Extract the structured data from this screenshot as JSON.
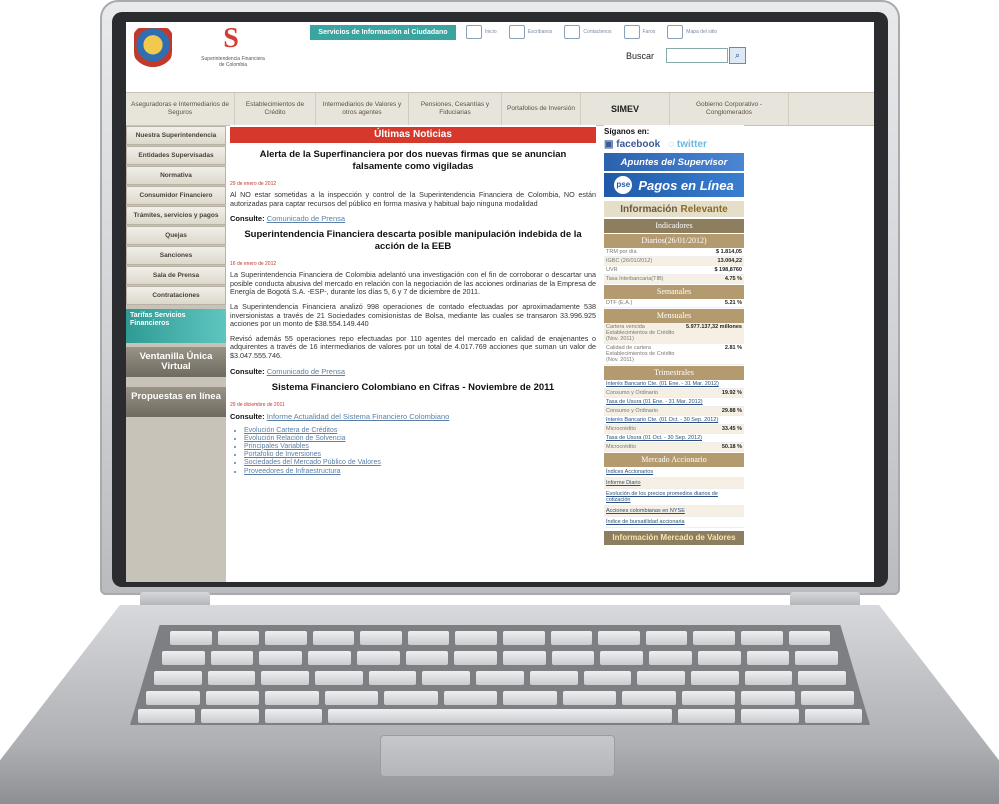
{
  "header": {
    "logo_text": "Superintendencia Financiera de Colombia",
    "services_bar": "Servicios de Información al Ciudadano",
    "top_links": [
      "Inicio",
      "Escribanos",
      "Contactenos",
      "Faros",
      "Mapa del sitio"
    ],
    "search_label": "Buscar"
  },
  "nav": [
    "Aseguradoras e Intermediarios de Seguros",
    "Establecimientos de Crédito",
    "Intermediarios de Valores y otros agentes",
    "Pensiones, Cesantías y Fiduciarias",
    "Portafolios de Inversión",
    "SIMEV",
    "Gobierno Corporativo - Conglomerados"
  ],
  "sidebar": {
    "items": [
      "Nuestra Superintendencia",
      "Entidades Supervisadas",
      "Normativa",
      "Consumidor Financiero",
      "Trámites, servicios y pagos",
      "Quejas",
      "Sanciones",
      "Sala de Prensa",
      "Contrataciones"
    ],
    "tarifas": "Tarifas Servicios Financieros",
    "ventanilla": "Ventanilla Única Virtual",
    "propuestas": "Propuestas en línea"
  },
  "main": {
    "section_title": "Últimas Noticias",
    "news": [
      {
        "title": "Alerta de la Superfinanciera por dos nuevas firmas que se anuncian falsamente como vigiladas",
        "date": "29 de enero de 2012",
        "paragraphs": [
          "Al NO estar sometidas a la inspección y control de la Superintendencia Financiera de Colombia, NO están autorizadas para captar recursos del público en forma masiva y habitual bajo ninguna modalidad"
        ],
        "consulte_label": "Consulte:",
        "consulte_link": "Comunicado de Prensa"
      },
      {
        "title": "Superintendencia Financiera descarta posible manipulación indebida de la acción de la EEB",
        "date": "16 de enero de 2012",
        "paragraphs": [
          "La Superintendencia Financiera de Colombia adelantó una investigación con el fin de corroborar o descartar una posible conducta abusiva del mercado en relación con la negociación de las acciones ordinarias de la Empresa de Energía de Bogotá S.A. -ESP-, durante los días 5, 6 y 7 de diciembre de 2011.",
          "La Superintendencia Financiera analizó 998 operaciones de contado efectuadas por aproximadamente 538 inversionistas a través de 21 Sociedades comisionistas de Bolsa, mediante las cuales se transaron 33.996.925 acciones por un monto de $38.554.149.440",
          "Revisó además 55 operaciones repo efectuadas por 110 agentes del mercado en calidad de enajenantes o adquirentes a través de 16 intermediarios de valores por un total de 4.017.769 acciones que suman un valor de $3.047.555.746."
        ],
        "consulte_label": "Consulte:",
        "consulte_link": "Comunicado de Prensa"
      },
      {
        "title": "Sistema Financiero Colombiano en Cifras - Noviembre de 2011",
        "date": "29 de diciembre de 2011",
        "paragraphs": [],
        "consulte_label": "Consulte:",
        "consulte_link": "Informe Actualidad del Sistema Financiero Colombiano",
        "bullets": [
          "Evolución Cartera de Créditos",
          "Evolución Relación de Solvencia",
          "Principales Variables",
          "Portafolio de Inversiones",
          "Sociedades del Mercado Público de Valores",
          "Proveedores de Infraestructura"
        ]
      }
    ]
  },
  "right": {
    "siganos": "Síganos en:",
    "facebook": "facebook",
    "twitter": "twitter",
    "apuntes": "Apuntes del Supervisor",
    "pagos": "Pagos en Línea",
    "pse": "pse",
    "relevante_a": "Información",
    "relevante_b": "Relevante",
    "indicadores": "Indicadores",
    "diarios": "Diarios(26/01/2012)",
    "diarios_rows": [
      {
        "label": "TRM por día",
        "value": "$ 1.814,05"
      },
      {
        "label": "IGBC (26/01/2012)",
        "value": "13.004,22"
      },
      {
        "label": "UVR",
        "value": "$ 198,8760"
      },
      {
        "label": "Tasa Interbancaria(TIB)",
        "value": "4.75 %"
      }
    ],
    "semanales": "Semanales",
    "semanales_rows": [
      {
        "label": "DTF (E.A.)",
        "value": "5.21 %"
      }
    ],
    "mensuales": "Mensuales",
    "mensuales_rows": [
      {
        "label": "Cartera vencida Establecimientos de Crédito (Nov. 2011)",
        "value": "5.977.137,32 millones"
      },
      {
        "label": "Calidad de cartera Establecimientos de Crédito (Nov. 2011)",
        "value": "2.81 %"
      }
    ],
    "trimestrales": "Trimestrales",
    "trimestrales_rows": [
      {
        "label": "Interés Bancario Cte. (01 Ene. - 31 Mar. 2012)",
        "value": ""
      },
      {
        "label": "Consumo y Ordinario",
        "value": "19.92 %"
      },
      {
        "label": "Tasa de Usura (01 Ene. - 31 Mar. 2012)",
        "value": ""
      },
      {
        "label": "Consumo y Ordinario",
        "value": "29.88 %"
      },
      {
        "label": "Interés Bancario Cte. (01 Oct. - 30 Sep. 2012)",
        "value": ""
      },
      {
        "label": "Microcrédito",
        "value": "33.45 %"
      },
      {
        "label": "Tasa de Usura (01 Oct. - 30 Sep. 2012)",
        "value": ""
      },
      {
        "label": "Microcrédito",
        "value": "50.18 %"
      }
    ],
    "accionario": "Mercado Accionario",
    "accionario_links": [
      "Índices Accionarios",
      "Informe Diario",
      "Evolución de los precios promedios diarios de cotización",
      "Acciones colombianas en NYSE",
      "Índice de bursatilidad accionaria"
    ],
    "mercado_valores": "Información Mercado de Valores"
  }
}
